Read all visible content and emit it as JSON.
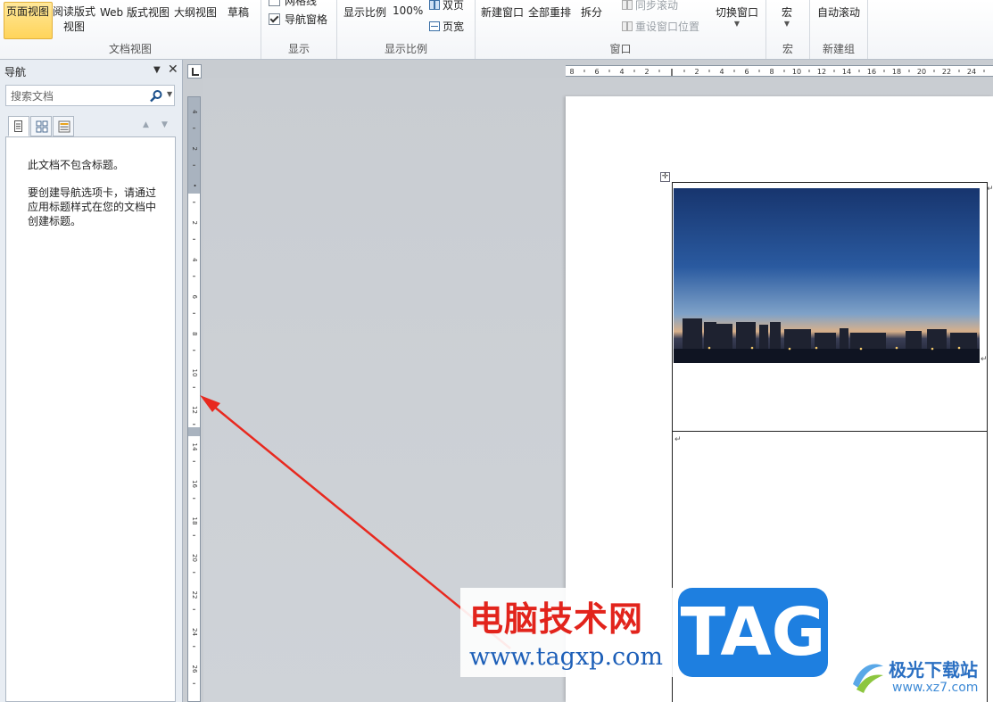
{
  "ribbon": {
    "document_views": {
      "print_layout": "页面视图",
      "full_screen_reading": "阅读版式",
      "full_screen_reading_2": "视图",
      "web_layout": "Web 版式视图",
      "outline": "大纲视图",
      "draft": "草稿",
      "group_label": "文档视图"
    },
    "show": {
      "gridlines": "网格线",
      "gridlines_checked": false,
      "nav_pane": "导航窗格",
      "nav_pane_checked": true,
      "group_label": "显示"
    },
    "zoom": {
      "zoom": "显示比例",
      "hundred": "100%",
      "two_pages": "双页",
      "page_width": "页宽",
      "group_label": "显示比例"
    },
    "window": {
      "new_window": "新建窗口",
      "arrange_all": "全部重排",
      "split": "拆分",
      "sync_scroll": "同步滚动",
      "reset_position": "重设窗口位置",
      "switch_windows": "切换窗口",
      "group_label": "窗口"
    },
    "macros": {
      "macros": "宏",
      "group_label": "宏"
    },
    "new_group": {
      "auto_scroll": "自动滚动",
      "group_label": "新建组"
    }
  },
  "nav_pane": {
    "title": "导航",
    "search_placeholder": "搜索文档",
    "message_no_headings": "此文档不包含标题。",
    "message_create": "要创建导航选项卡，请通过应用标题样式在您的文档中创建标题。"
  },
  "vertical_ruler": {
    "labels": [
      "4",
      "2",
      "",
      "2",
      "4",
      "6",
      "8",
      "10",
      "12",
      "14",
      "16",
      "18",
      "20",
      "22",
      "24",
      "26",
      "28"
    ]
  },
  "horizontal_ruler": {
    "labels": [
      "8",
      "6",
      "4",
      "2",
      "",
      "2",
      "4",
      "6",
      "8",
      "10",
      "12",
      "14",
      "16",
      "18",
      "20",
      "22",
      "24"
    ]
  },
  "watermarks": {
    "site_title": "电脑技术网",
    "site_url": "www.tagxp.com",
    "tag": "TAG",
    "logo_name": "极光下载站",
    "logo_url": "www.xz7.com"
  },
  "colors": {
    "annotation_arrow": "#e8291f",
    "tag_background": "#1e7fe0",
    "active_view_button": "#ffd45a"
  }
}
